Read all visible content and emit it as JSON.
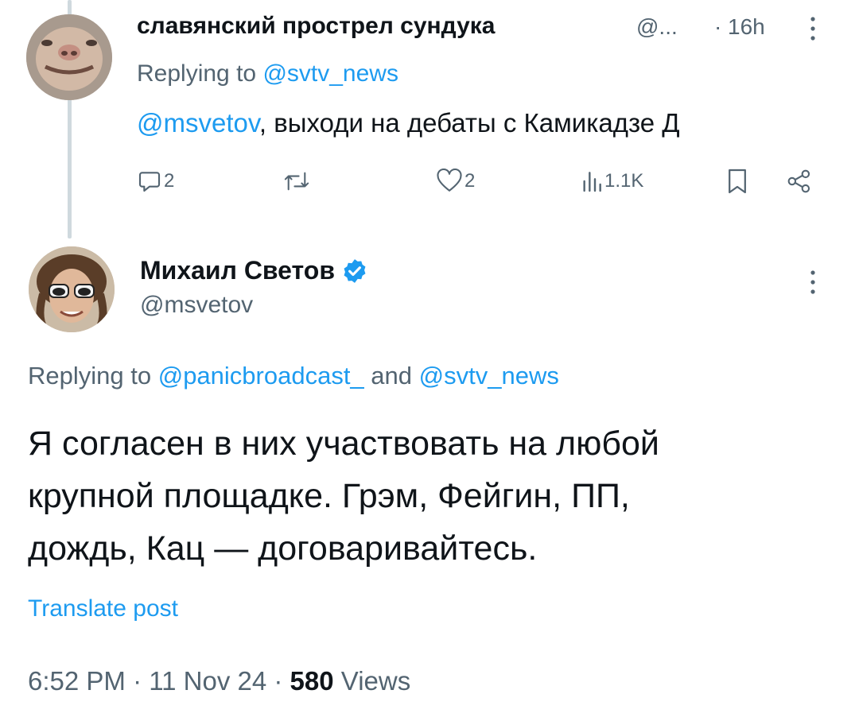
{
  "reply_tweet": {
    "author_name": "славянский прострел сундука",
    "author_handle": "@...",
    "separator": "·",
    "time": "16h",
    "replying_prefix": "Replying to ",
    "replying_to": "@svtv_news",
    "text_mention": "@msvetov",
    "text_rest": ", выходи на дебаты с Камикадзе Д",
    "actions": {
      "replies": "2",
      "likes": "2",
      "views": "1.1K"
    }
  },
  "main_tweet": {
    "author_name": "Михаил Светов",
    "author_handle": "@msvetov",
    "replying_prefix": "Replying to ",
    "replying_to_1": "@panicbroadcast_",
    "replying_and": " and ",
    "replying_to_2": "@svtv_news",
    "text_line1": "Я согласен в них участвовать на любой",
    "text_line2": "крупной площадке. Грэм, Фейгин, ПП,",
    "text_line3": "дождь, Кац — договаривайтесь.",
    "translate_label": "Translate post",
    "time": "6:52 PM",
    "separator": " · ",
    "date": "11 Nov 24",
    "views_count": "580",
    "views_label": " Views"
  },
  "colors": {
    "link": "#1d9bf0",
    "secondary_text": "#536471",
    "primary_text": "#0f1419",
    "verified_badge": "#1d9bf0"
  },
  "icons": [
    "reply-icon",
    "retweet-icon",
    "like-icon",
    "views-icon",
    "bookmark-icon",
    "share-icon",
    "more-icon",
    "verified-badge-icon"
  ]
}
